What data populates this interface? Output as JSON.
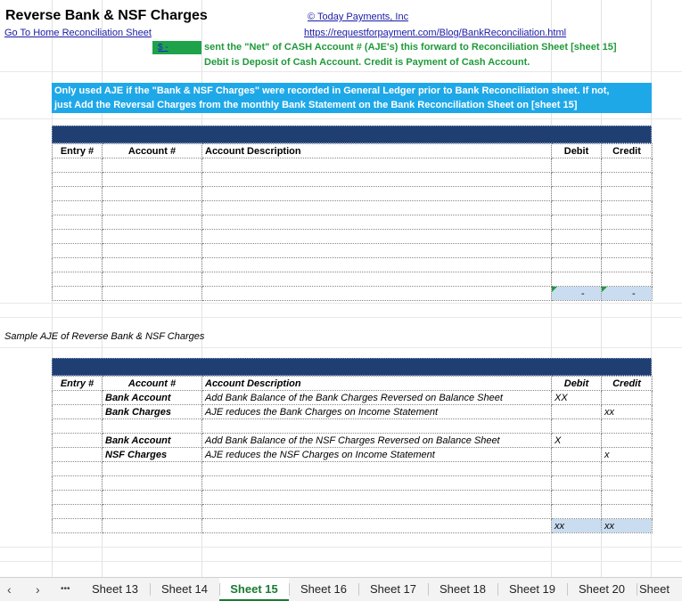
{
  "sheet": {
    "title": "Reverse Bank & NSF Charges",
    "copyright_link": "© Today Payments, Inc",
    "home_link": "Go To Home Reconciliation Sheet",
    "url_link": "https://requestforpayment.com/Blog/BankReconciliation.html",
    "cash_cell_value": "$          -",
    "instruction_line1": "sent the \"Net\" of CASH Account # (AJE's) this forward to Reconciliation Sheet [sheet 15]",
    "instruction_line2": "Debit is Deposit of Cash Account.  Credit is Payment of Cash Account.",
    "note_line1": "Only used AJE if the \"Bank & NSF Charges\" were recorded in General Ledger prior to Bank Reconciliation sheet.  If not,",
    "note_line2": "just Add the Reversal Charges from the monthly Bank Statement on the Bank Reconciliation Sheet on [sheet 15]",
    "sample_caption": "Sample AJE of Reverse Bank & NSF Charges"
  },
  "table1": {
    "headers": [
      "Entry #",
      "Account #",
      "Account Description",
      "Debit",
      "Credit"
    ],
    "total_debit": "-",
    "total_credit": "-"
  },
  "table2": {
    "headers": [
      "Entry #",
      "Account #",
      "Account Description",
      "Debit",
      "Credit"
    ],
    "rows": [
      {
        "entry": "",
        "account": "Bank Account",
        "description": "Add Bank Balance of the Bank Charges Reversed on Balance Sheet",
        "debit": "XX",
        "credit": ""
      },
      {
        "entry": "",
        "account": "Bank Charges",
        "description": "AJE reduces the Bank Charges on Income Statement",
        "debit": "",
        "credit": "xx"
      },
      {
        "entry": "",
        "account": "",
        "description": "",
        "debit": "",
        "credit": ""
      },
      {
        "entry": "",
        "account": "Bank Account",
        "description": "Add Bank Balance of the NSF Charges Reversed on Balance Sheet",
        "debit": "X",
        "credit": ""
      },
      {
        "entry": "",
        "account": "NSF Charges",
        "description": "AJE reduces the NSF Charges on Income Statement",
        "debit": "",
        "credit": "x"
      }
    ],
    "total_debit": "xx",
    "total_credit": "xx"
  },
  "tabs": {
    "prev_icon": "chevron-left-icon",
    "next_icon": "chevron-right-icon",
    "more_label": "•••",
    "items": [
      "Sheet 13",
      "Sheet 14",
      "Sheet 15",
      "Sheet 16",
      "Sheet 17",
      "Sheet 18",
      "Sheet 19",
      "Sheet 20",
      "Sheet"
    ],
    "active": "Sheet 15",
    "active_color": "#1a7a30"
  },
  "colors": {
    "note_bg": "#1fa8e8",
    "band_bg": "#1f3f73",
    "cash_cell_bg": "#1ea24a",
    "total_bg": "#c9dcf0",
    "instruction_text": "#1f9a3a"
  }
}
